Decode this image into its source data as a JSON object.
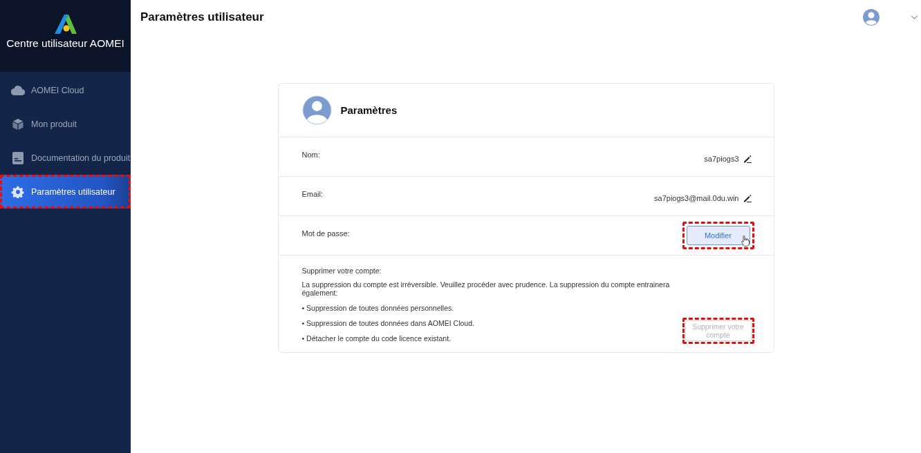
{
  "sidebar": {
    "title": "Centre utilisateur AOMEI",
    "items": [
      {
        "label": "AOMEI Cloud",
        "kind": "cloud",
        "selected": false,
        "highlighted": false
      },
      {
        "label": "Mon produit",
        "kind": "box",
        "selected": false,
        "highlighted": false
      },
      {
        "label": "Documentation du produit",
        "kind": "doc",
        "selected": false,
        "highlighted": false
      },
      {
        "label": "Paramètres utilisateur",
        "kind": "gear",
        "selected": true,
        "highlighted": true
      }
    ]
  },
  "header": {
    "title": "Paramètres utilisateur"
  },
  "card": {
    "title": "Paramètres",
    "fields": [
      {
        "label": "Nom:",
        "kind": "editable",
        "value": "sa7piogs3"
      },
      {
        "label": "Email:",
        "kind": "editable",
        "value": "sa7piogs3@mail.0du.win"
      },
      {
        "label": "Mot de passe:",
        "kind": "button",
        "button": {
          "label": "Modifier",
          "highlighted": true,
          "hovered": true
        }
      }
    ],
    "delete": {
      "heading": "Supprimer votre compte:",
      "text": "La suppression du compte est irréversible. Veuillez procéder avec prudence. La suppression du compte entrainera également:",
      "bullets": [
        "• Suppression de toutes données personnelles.",
        "• Suppression de toutes données dans AOMEI Cloud.",
        "• Détacher le compte du code licence existant."
      ],
      "button": {
        "label": "Supprimer votre compte",
        "disabled": true,
        "highlighted": true
      }
    }
  }
}
